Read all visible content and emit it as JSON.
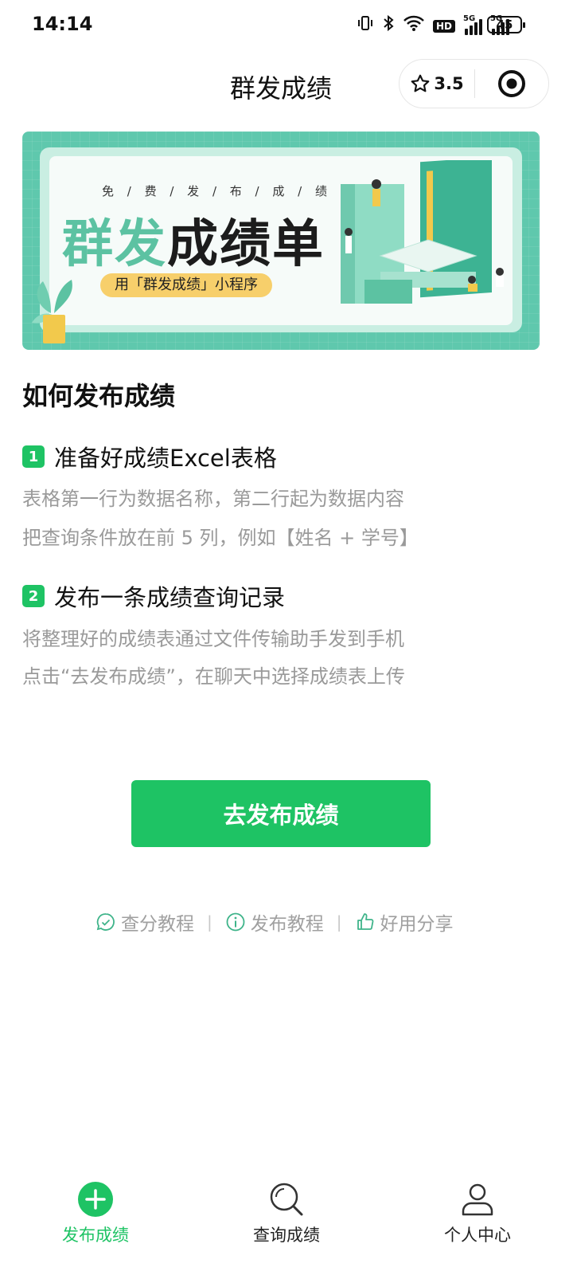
{
  "status_bar": {
    "time": "14:14",
    "hd_label": "HD",
    "sim1_label": "5G",
    "sim2_label": "5G",
    "battery": "45"
  },
  "nav": {
    "title": "群发成绩",
    "rating": "3.5"
  },
  "banner": {
    "subtitle": "免 / 费 / 发 / 布 / 成 / 绩",
    "headline_green": "群发",
    "headline_dark": "成绩单",
    "pill_text": "用「群发成绩」小程序"
  },
  "guide": {
    "heading": "如何发布成绩",
    "steps": [
      {
        "number": "1",
        "title": "准备好成绩Excel表格",
        "lines": [
          "表格第一行为数据名称，第二行起为数据内容",
          "把查询条件放在前 5 列，例如【姓名 + 学号】"
        ]
      },
      {
        "number": "2",
        "title": "发布一条成绩查询记录",
        "lines": [
          "将整理好的成绩表通过文件传输助手发到手机",
          "点击“去发布成绩”，在聊天中选择成绩表上传"
        ]
      }
    ]
  },
  "primary_button": "去发布成绩",
  "links": [
    {
      "label": "查分教程",
      "icon": "chat-check-icon"
    },
    {
      "label": "发布教程",
      "icon": "info-icon"
    },
    {
      "label": "好用分享",
      "icon": "thumbs-up-icon"
    }
  ],
  "link_separator": "|",
  "tabbar": {
    "items": [
      {
        "label": "发布成绩",
        "icon": "plus-circle-icon",
        "active": true
      },
      {
        "label": "查询成绩",
        "icon": "search-icon",
        "active": false
      },
      {
        "label": "个人中心",
        "icon": "user-icon",
        "active": false
      }
    ]
  },
  "colors": {
    "accent": "#1ec364",
    "banner_teal": "#5fc8ad",
    "muted_text": "#9a9a9a"
  }
}
